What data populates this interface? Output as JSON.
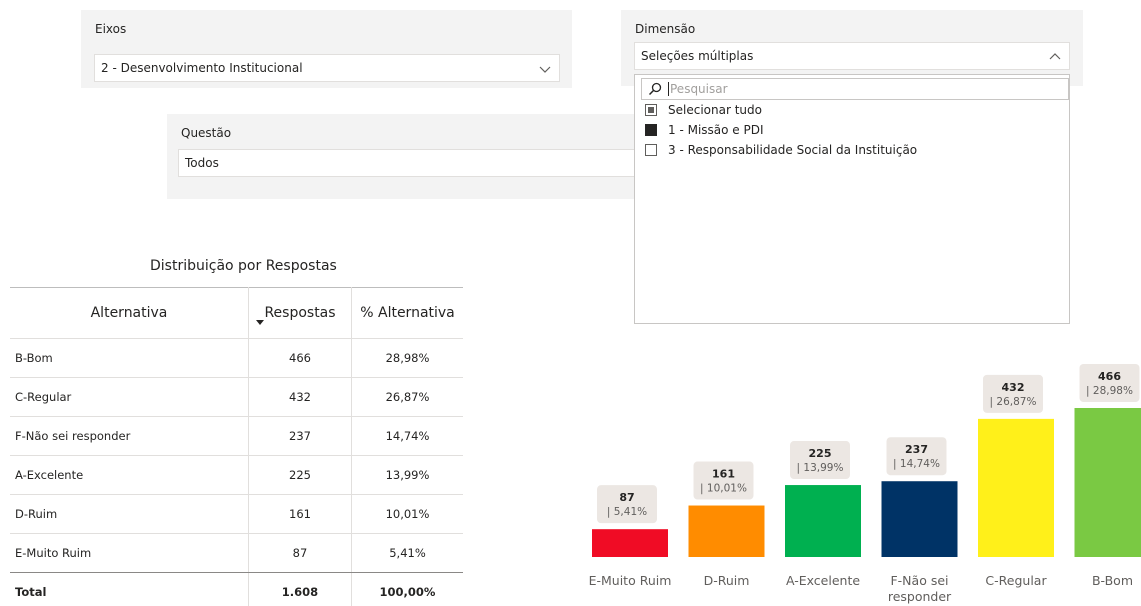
{
  "filters": {
    "eixos": {
      "title": "Eixos",
      "value": "2 - Desenvolvimento Institucional"
    },
    "dimensao": {
      "title": "Dimensão",
      "value": "Seleções múltiplas"
    },
    "questao": {
      "title": "Questão",
      "value": "Todos"
    }
  },
  "dropdown": {
    "search_placeholder": "Pesquisar",
    "options": [
      {
        "label": "Selecionar tudo",
        "state": "partial"
      },
      {
        "label": "1 - Missão e PDI",
        "state": "checked"
      },
      {
        "label": "3 - Responsabilidade Social da Instituição",
        "state": "unchecked"
      }
    ]
  },
  "table": {
    "title": "Distribuição por Respostas",
    "columns": [
      "Alternativa",
      "Respostas",
      "% Alternativa"
    ],
    "rows": [
      [
        "B-Bom",
        "466",
        "28,98%"
      ],
      [
        "C-Regular",
        "432",
        "26,87%"
      ],
      [
        "F-Não sei responder",
        "237",
        "14,74%"
      ],
      [
        "A-Excelente",
        "225",
        "13,99%"
      ],
      [
        "D-Ruim",
        "161",
        "10,01%"
      ],
      [
        "E-Muito Ruim",
        "87",
        "5,41%"
      ]
    ],
    "total": [
      "Total",
      "1.608",
      "100,00%"
    ]
  },
  "chart_data": {
    "type": "bar",
    "categories": [
      "E-Muito Ruim",
      "D-Ruim",
      "A-Excelente",
      "F-Não sei responder",
      "C-Regular",
      "B-Bom"
    ],
    "values": [
      87,
      161,
      225,
      237,
      432,
      466
    ],
    "data_labels": [
      "| 5,41%",
      "| 10,01%",
      "| 13,99%",
      "| 14,74%",
      "| 26,87%",
      "| 28,98%"
    ],
    "colors": [
      "#F00C25",
      "#FF8C00",
      "#00B050",
      "#003366",
      "#FFF01A",
      "#7AC943"
    ],
    "ylim": [
      0,
      466
    ]
  }
}
